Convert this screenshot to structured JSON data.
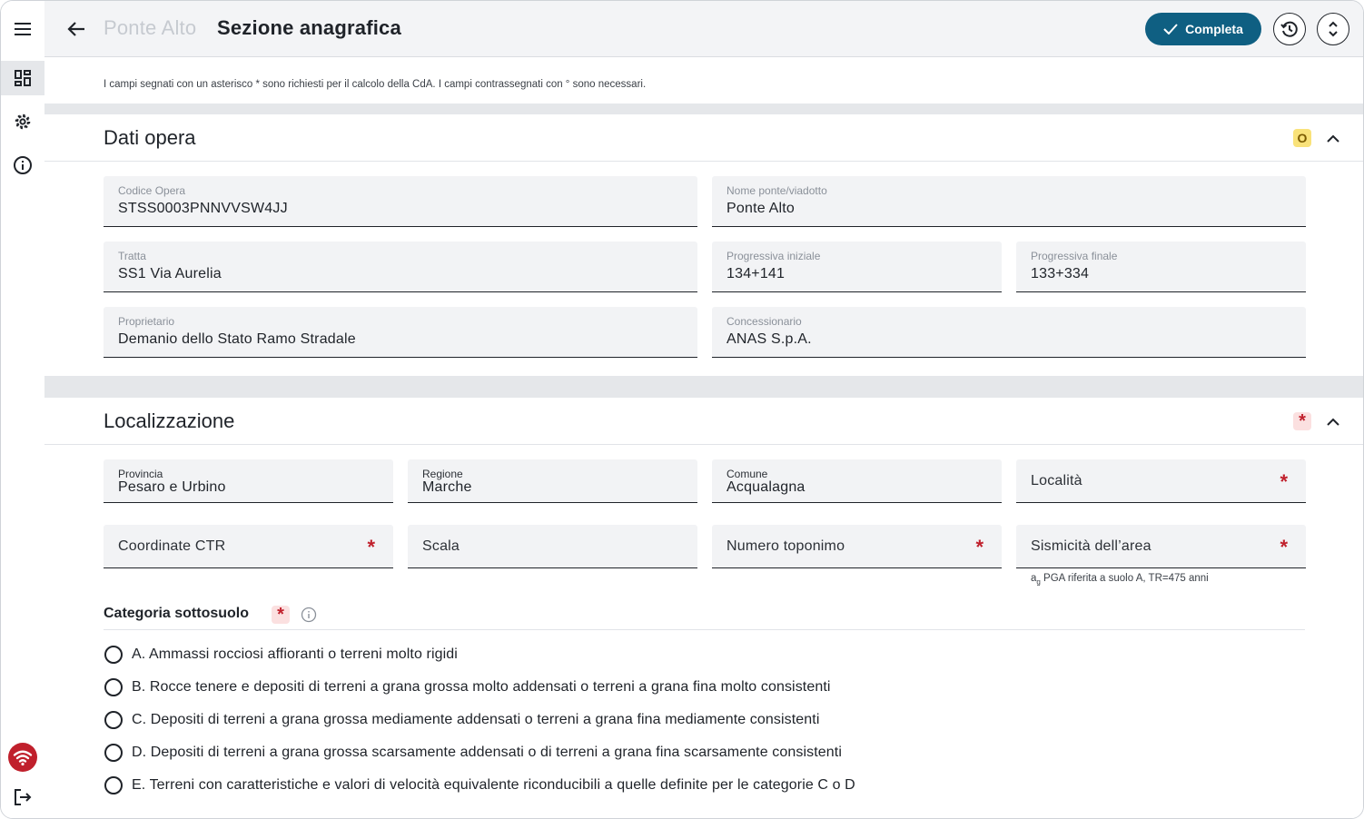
{
  "header": {
    "breadcrumb": "Ponte Alto",
    "title": "Sezione anagrafica",
    "complete_label": "Completa"
  },
  "note": "I campi segnati con un asterisco * sono richiesti per il calcolo della CdA. I campi contrassegnati con ° sono necessari.",
  "sections": {
    "dati_opera": {
      "title": "Dati opera",
      "badge": "O",
      "fields": {
        "codice_opera": {
          "label": "Codice Opera",
          "value": "STSS0003PNNVVSW4JJ"
        },
        "nome_ponte": {
          "label": "Nome ponte/viadotto",
          "value": "Ponte Alto"
        },
        "tratta": {
          "label": "Tratta",
          "value": "SS1 Via Aurelia"
        },
        "progressiva_iniziale": {
          "label": "Progressiva iniziale",
          "value": "134+141"
        },
        "progressiva_finale": {
          "label": "Progressiva finale",
          "value": "133+334"
        },
        "proprietario": {
          "label": "Proprietario",
          "value": "Demanio dello Stato Ramo Stradale"
        },
        "concessionario": {
          "label": "Concessionario",
          "value": "ANAS S.p.A."
        }
      }
    },
    "localizzazione": {
      "title": "Localizzazione",
      "badge": "*",
      "fields": {
        "provincia": {
          "label": "Provincia",
          "value": "Pesaro e Urbino"
        },
        "regione": {
          "label": "Regione",
          "value": "Marche"
        },
        "comune": {
          "label": "Comune",
          "value": "Acqualagna"
        },
        "localita": {
          "placeholder": "Località",
          "required": "*"
        },
        "coordinate_ctr": {
          "placeholder": "Coordinate CTR",
          "required": "*"
        },
        "scala": {
          "placeholder": "Scala"
        },
        "numero_toponimo": {
          "placeholder": "Numero toponimo",
          "required": "*"
        },
        "sismicita": {
          "placeholder": "Sismicità dell’area",
          "required": "*"
        }
      },
      "sismicita_hint_prefix": "a",
      "sismicita_hint_sub": "g",
      "sismicita_hint_text": " PGA riferita a suolo A, TR=475 anni",
      "categoria": {
        "title": "Categoria sottosuolo",
        "required": "*",
        "options": [
          "A. Ammassi rocciosi affioranti o terreni molto rigidi",
          "B. Rocce tenere e depositi di terreni a grana grossa molto addensati o terreni a grana fina molto consistenti",
          "C. Depositi di terreni a grana grossa mediamente addensati o terreni a grana fina mediamente consistenti",
          "D. Depositi di terreni a grana grossa scarsamente addensati o di terreni a grana fina scarsamente consistenti",
          "E. Terreni con caratteristiche e valori di velocità equivalente riconducibili a quelle definite per le categorie C o D"
        ]
      }
    }
  },
  "colors": {
    "primary": "#0f5f82",
    "required": "#c0202c",
    "badge_o": "#f9e27a",
    "wifi_alert": "#c0202c"
  }
}
